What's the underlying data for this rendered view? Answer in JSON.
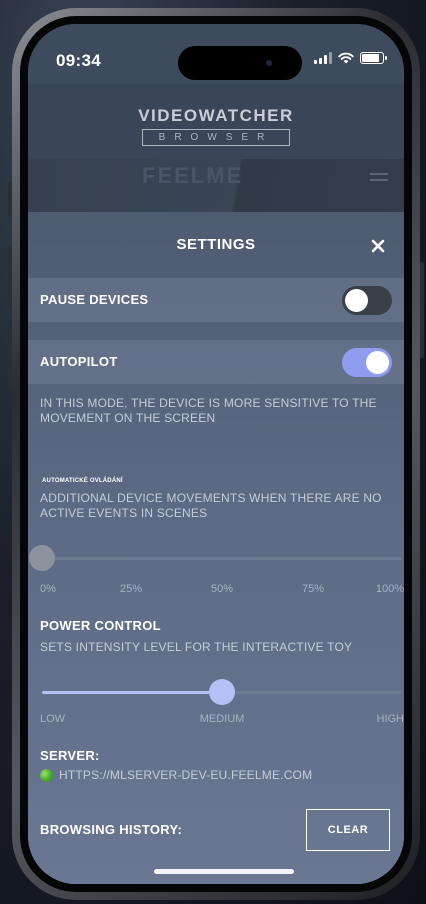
{
  "status_bar": {
    "time": "09:34"
  },
  "header": {
    "brand_name": "VIDEOWATCHER",
    "brand_sub": "BROWSER",
    "banner_logo": "FEELME"
  },
  "settings": {
    "title": "SETTINGS",
    "close_icon": "close-icon",
    "pause_devices": {
      "label": "PAUSE DEVICES",
      "enabled": false
    },
    "autopilot": {
      "label": "AUTOPILOT",
      "enabled": true,
      "description": "IN THIS MODE, THE DEVICE IS MORE SENSITIVE TO THE MOVEMENT ON THE SCREEN"
    },
    "auto_control": {
      "label": "AUTOMATICKÉ OVLÁDÁNÍ",
      "description": "ADDITIONAL DEVICE MOVEMENTS WHEN THERE ARE NO ACTIVE EVENTS IN SCENES",
      "value_percent": 0,
      "ticks": [
        "0%",
        "25%",
        "50%",
        "75%",
        "100%"
      ]
    },
    "power_control": {
      "title": "POWER CONTROL",
      "description": "SETS INTENSITY LEVEL FOR THE INTERACTIVE TOY",
      "value_fraction": 0.5,
      "ticks": [
        "LOW",
        "MEDIUM",
        "HIGH"
      ]
    },
    "server": {
      "title": "SERVER:",
      "url": "HTTPS://MLSERVER-DEV-EU.FEELME.COM",
      "status_color": "#3ea82a"
    },
    "browsing_history": {
      "title": "BROWSING HISTORY:",
      "clear_label": "CLEAR"
    }
  },
  "colors": {
    "accent": "#8f9cf0",
    "panel": "#5d6a84",
    "toggle_off": "#3a3f48"
  }
}
